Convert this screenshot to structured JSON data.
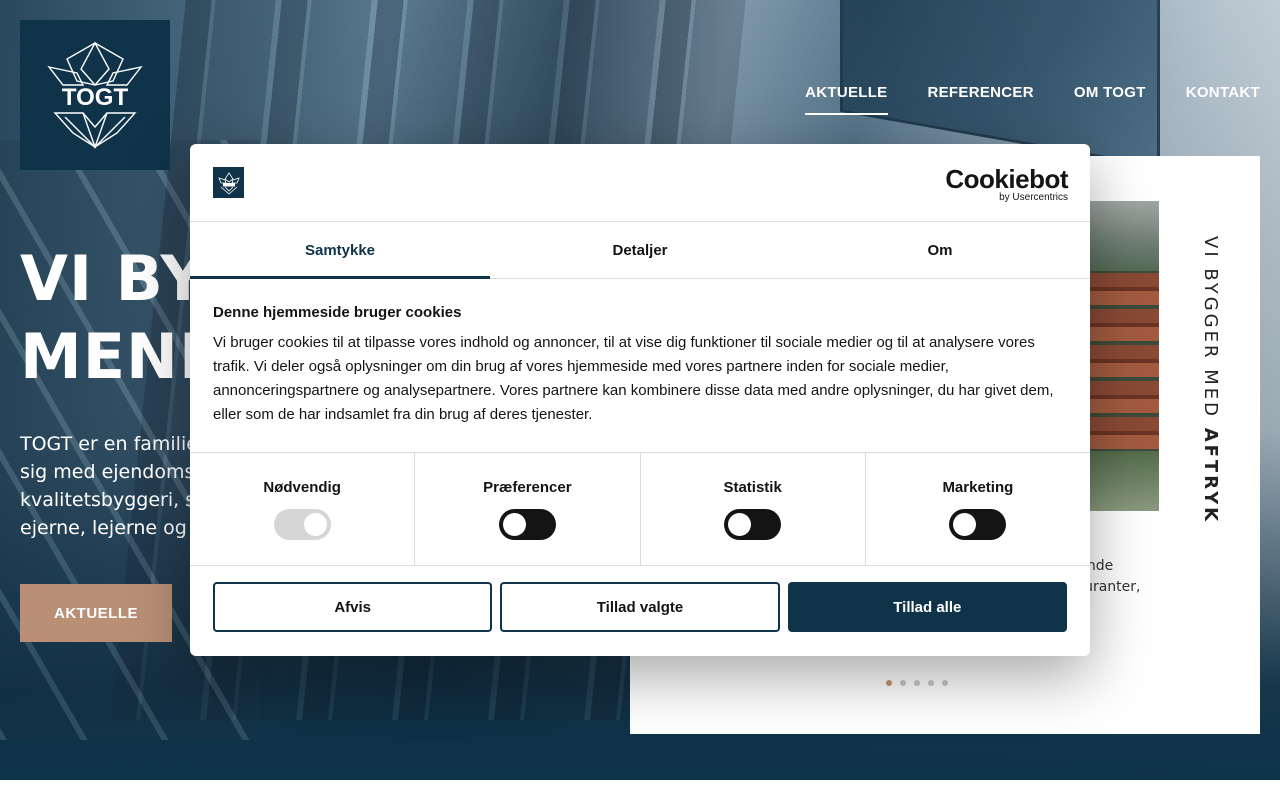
{
  "site": {
    "logo_text": "TOGT",
    "nav": [
      {
        "label": "AKTUELLE",
        "active": true
      },
      {
        "label": "REFERENCER",
        "active": false
      },
      {
        "label": "OM TOGT",
        "active": false
      },
      {
        "label": "KONTAKT",
        "active": false
      }
    ]
  },
  "hero": {
    "title_line1": "VI BYG",
    "title_line2": "MENN",
    "text_line1": "TOGT er en familiee",
    "text_line2": "sig med ejendomsu",
    "text_line3": "kvalitetsbyggeri, so",
    "text_line4": "ejerne, lejerne og lo",
    "button_label": "AKTUELLE"
  },
  "card": {
    "vertical_text_light": "VI BYGGER MED ",
    "vertical_text_bold": "AFTRYK",
    "snippet_line1": "vende",
    "snippet_line2": "tauranter,",
    "dots_count": 5,
    "active_dot": 0
  },
  "cookie": {
    "brand_name": "Cookiebot",
    "brand_sub": "by Usercentrics",
    "tabs": [
      {
        "label": "Samtykke",
        "active": true
      },
      {
        "label": "Detaljer",
        "active": false
      },
      {
        "label": "Om",
        "active": false
      }
    ],
    "title": "Denne hjemmeside bruger cookies",
    "text": "Vi bruger cookies til at tilpasse vores indhold og annoncer, til at vise dig funktioner til sociale medier og til at analysere vores trafik. Vi deler også oplysninger om din brug af vores hjemmeside med vores partnere inden for sociale medier, annonceringspartnere og analysepartnere. Vores partnere kan kombinere disse data med andre oplysninger, du har givet dem, eller som de har indsamlet fra din brug af deres tjenester.",
    "categories": [
      {
        "label": "Nødvendig",
        "enabled": true,
        "locked": true
      },
      {
        "label": "Præferencer",
        "enabled": false,
        "locked": false
      },
      {
        "label": "Statistik",
        "enabled": false,
        "locked": false
      },
      {
        "label": "Marketing",
        "enabled": false,
        "locked": false
      }
    ],
    "buttons": {
      "deny": "Afvis",
      "allow_selected": "Tillad valgte",
      "allow_all": "Tillad alle"
    }
  },
  "colors": {
    "brand_navy": "#0f3349",
    "accent_copper": "#b98f76",
    "dot_active": "#c9946f"
  }
}
